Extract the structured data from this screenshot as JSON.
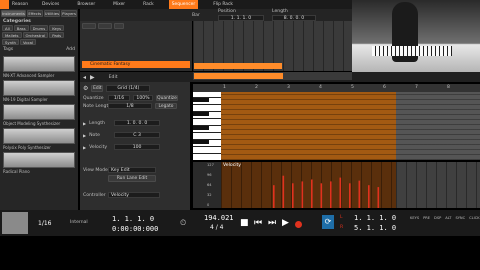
{
  "topbar": {
    "app_name": "Reason",
    "tabs": [
      "Devices",
      "Browser",
      "Mixer",
      "Rack",
      "Sequencer",
      "Flip Rack"
    ],
    "active_tab": "Sequencer"
  },
  "browser": {
    "tabs": [
      "Instruments",
      "Effects",
      "Utilities",
      "Players"
    ],
    "categories_title": "Categories",
    "categories": [
      "All",
      "Bass",
      "Drums",
      "Keys",
      "Mallets",
      "Orchestral",
      "Pads",
      "Synth",
      "Vocal"
    ],
    "tags_title": "Tags",
    "tags_add": "Add",
    "devices": [
      {
        "name": "NN-XT Advanced Sampler"
      },
      {
        "name": "NN-19 Digital Sampler"
      },
      {
        "name": "Object Modeling Synthesizer"
      },
      {
        "name": "Polysix Poly Synthesizer"
      },
      {
        "name": "Radical Piano"
      }
    ]
  },
  "sequencer": {
    "bar_label": "Bar",
    "position_label": "Position",
    "length_label": "Length",
    "position_value": "1. 1. 1. 0",
    "length_value": "8. 0. 0. 0",
    "track_name": "Cinematic Fantasy",
    "ruler": [
      "1",
      "2",
      "3",
      "4",
      "5",
      "6",
      "7",
      "8"
    ]
  },
  "editor": {
    "edit_label": "Edit",
    "grid_label": "Grid (1/4)",
    "quantize_label": "Quantize",
    "quantize_value": "1/16",
    "quantize_pct": "100%",
    "quantize_btn": "Quantize",
    "swing_label": "Note Lengths",
    "swing_value": "1/8",
    "swing_btn": "Legato",
    "inspector": [
      {
        "label": "Length",
        "value": "1. 0. 0. 0"
      },
      {
        "label": "Note",
        "value": "C 3"
      },
      {
        "label": "Velocity",
        "value": "100"
      }
    ],
    "view_mode_label": "View Mode",
    "view_mode_value": "Key Edit",
    "run_edit": "Run Lane Edit",
    "controller_label": "Controller",
    "controller_value": "Velocity",
    "velocity_lane_title": "Velocity",
    "vel_scale": [
      "127",
      "96",
      "64",
      "32",
      "0"
    ],
    "velocity_bars": [
      0.6,
      0.85,
      0.65,
      0.7,
      0.75,
      0.65,
      0.7,
      0.8,
      0.65,
      0.72,
      0.6,
      0.55
    ]
  },
  "transport": {
    "pre_count": "1/16",
    "click": "Internal",
    "song_pos": "1. 1. 1. 0",
    "time": "0:00:00:000",
    "tempo": "194.021",
    "signature": "4 / 4",
    "left": "1. 1. 1. 0",
    "right": "5. 1. 1. 0",
    "loop_l_label": "L",
    "loop_r_label": "R",
    "labels": [
      "KEYS",
      "PRE",
      "DSP",
      "ALT",
      "SYNC",
      "CLICK"
    ]
  },
  "colors": {
    "accent": "#ff7a1a",
    "note_area": "#a35a12",
    "note_area_empty": "#555555",
    "velocity_bar": "#e0321e"
  }
}
